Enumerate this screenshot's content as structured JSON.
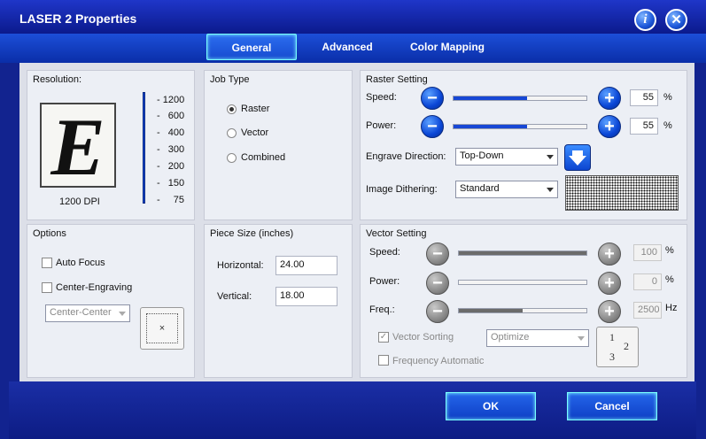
{
  "window": {
    "title": "LASER 2 Properties"
  },
  "tabs": {
    "general": "General",
    "advanced": "Advanced",
    "color": "Color Mapping"
  },
  "resolution": {
    "title": "Resolution:",
    "preview_letter": "E",
    "dpi_label": "1200 DPI",
    "ticks": [
      "1200",
      "600",
      "400",
      "300",
      "200",
      "150",
      "75"
    ]
  },
  "job_type": {
    "title": "Job Type",
    "options": [
      "Raster",
      "Vector",
      "Combined"
    ],
    "selected": "Raster"
  },
  "raster": {
    "title": "Raster Setting",
    "speed_label": "Speed:",
    "speed_value": "55",
    "power_label": "Power:",
    "power_value": "55",
    "unit": "%",
    "direction_label": "Engrave Direction:",
    "direction_value": "Top-Down",
    "dithering_label": "Image Dithering:",
    "dithering_value": "Standard"
  },
  "options": {
    "title": "Options",
    "auto_focus": "Auto Focus",
    "center_engraving": "Center-Engraving",
    "center_select": "Center-Center"
  },
  "piece_size": {
    "title": "Piece Size (inches)",
    "horizontal_label": "Horizontal:",
    "horizontal_value": "24.00",
    "vertical_label": "Vertical:",
    "vertical_value": "18.00"
  },
  "vector": {
    "title": "Vector Setting",
    "speed_label": "Speed:",
    "speed_value": "100",
    "power_label": "Power:",
    "power_value": "0",
    "freq_label": "Freq.:",
    "freq_value": "2500",
    "unit_pct": "%",
    "unit_hz": "Hz",
    "sorting_label": "Vector Sorting",
    "sorting_value": "Optimize",
    "freq_auto_label": "Frequency Automatic"
  },
  "footer": {
    "ok": "OK",
    "cancel": "Cancel"
  },
  "levels": {
    "raster_speed": 0.55,
    "raster_power": 0.55,
    "vector_speed": 1.0,
    "vector_power": 0.0,
    "vector_freq": 0.5
  },
  "colors": {
    "accent": "#1747d5",
    "window": "#12238f"
  }
}
